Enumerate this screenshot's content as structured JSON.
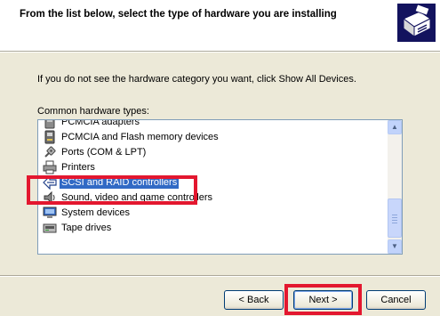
{
  "header": {
    "title": "From the list below, select the type of hardware you are installing",
    "icon": "hardware-wizard-icon"
  },
  "info_text": "If you do not see the hardware category you want, click Show All Devices.",
  "list_label": "Common hardware types:",
  "hardware_list": {
    "items": [
      {
        "label": "PCMCIA adapters",
        "icon": "pcmcia-icon"
      },
      {
        "label": "PCMCIA and Flash memory devices",
        "icon": "flash-memory-icon"
      },
      {
        "label": "Ports (COM & LPT)",
        "icon": "port-icon"
      },
      {
        "label": "Printers",
        "icon": "printer-icon"
      },
      {
        "label": "SCSI and RAID controllers",
        "icon": "scsi-icon",
        "selected": true
      },
      {
        "label": "Sound, video and game controllers",
        "icon": "sound-icon"
      },
      {
        "label": "System devices",
        "icon": "system-devices-icon"
      },
      {
        "label": "Tape drives",
        "icon": "tape-drive-icon"
      }
    ]
  },
  "buttons": {
    "back": "< Back",
    "next": "Next >",
    "cancel": "Cancel"
  },
  "colors": {
    "selection": "#316ac5",
    "highlight_box": "#e3172f",
    "dialog_bg": "#ece9d8"
  }
}
